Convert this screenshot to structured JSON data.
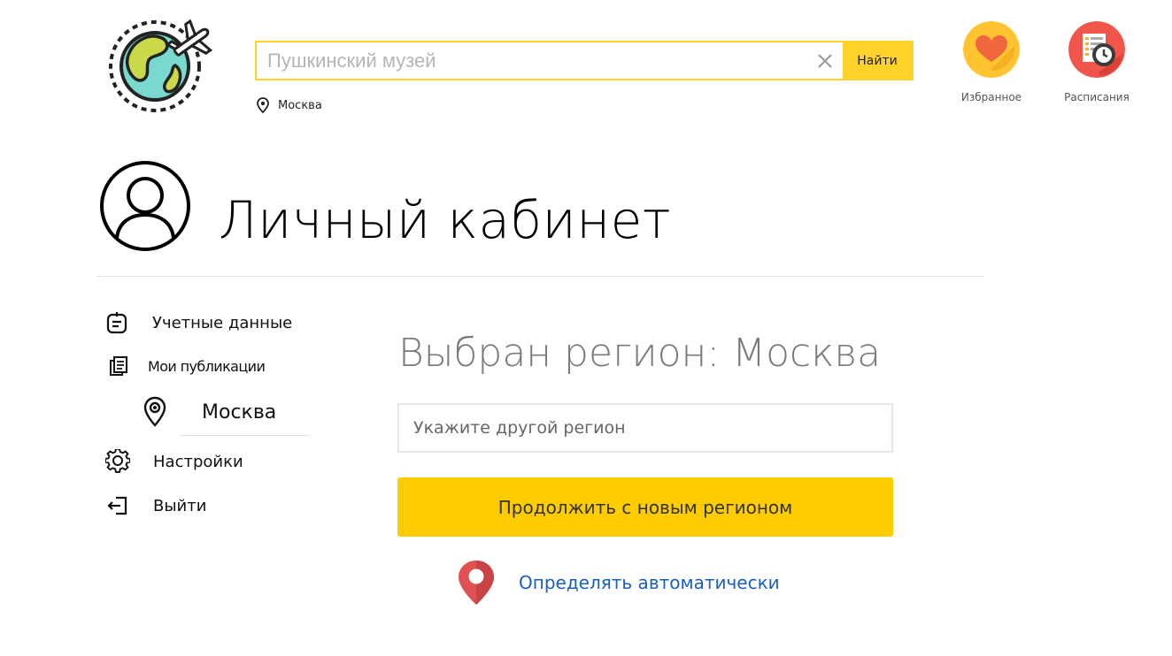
{
  "header": {
    "search": {
      "placeholder": "Пушкинский музей",
      "value": "",
      "button_label": "Найти"
    },
    "city": "Москва",
    "favorites_label": "Избранное",
    "schedules_label": "Расписания"
  },
  "page": {
    "title": "Личный кабинет"
  },
  "sidebar": {
    "items": [
      {
        "label": "Учетные данные",
        "icon": "id-card-icon"
      },
      {
        "label": "Мои публикации",
        "icon": "documents-icon"
      },
      {
        "label": "Москва",
        "icon": "location-pin-icon"
      },
      {
        "label": "Настройки",
        "icon": "gear-icon"
      },
      {
        "label": "Выйти",
        "icon": "logout-icon"
      }
    ]
  },
  "region": {
    "heading": "Выбран регион: Москва",
    "input_placeholder": "Укажите другой регион",
    "input_value": "",
    "continue_label": "Продолжить с новым регионом",
    "auto_label": "Определять автоматически"
  },
  "colors": {
    "accent_yellow": "#ffcc00",
    "search_border": "#ffd32a",
    "link_blue": "#1a5fc0",
    "heading_gray": "#7a7a7a",
    "pin_red": "#e05252"
  }
}
